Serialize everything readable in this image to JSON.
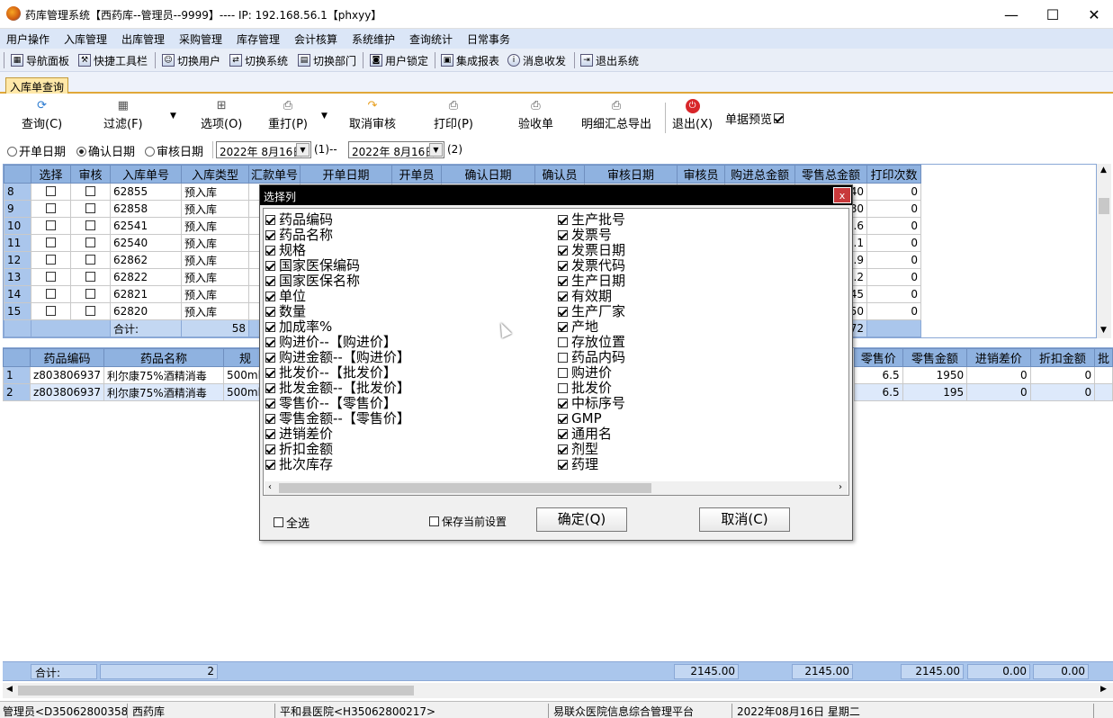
{
  "window": {
    "title": "药库管理系统【西药库--管理员--9999】---- IP: 192.168.56.1【phxyy】",
    "controls": [
      "—",
      "☐",
      "✕"
    ]
  },
  "menu": [
    "用户操作",
    "入库管理",
    "出库管理",
    "采购管理",
    "库存管理",
    "会计核算",
    "系统维护",
    "查询统计",
    "日常事务"
  ],
  "toolbar": [
    "导航面板",
    "快捷工具栏",
    "切换用户",
    "切换系统",
    "切换部门",
    "用户锁定",
    "集成报表",
    "消息收发",
    "退出系统"
  ],
  "tab": "入库单查询",
  "actions": [
    "查询(C)",
    "过滤(F)",
    "选项(O)",
    "重打(P)",
    "取消审核",
    "打印(P)",
    "验收单",
    "明细汇总导出",
    "退出(X)"
  ],
  "preview_label": "单据预览",
  "date_filter": {
    "options": [
      "开单日期",
      "确认日期",
      "审核日期"
    ],
    "selected": "确认日期",
    "from": "2022年 8月16日",
    "to": "2022年 8月16日",
    "sep": "(1)--",
    "end": "(2)"
  },
  "upper_table": {
    "headers": [
      "选择",
      "审核",
      "入库单号",
      "入库类型",
      "汇款单号",
      "开单日期",
      "开单员",
      "确认日期",
      "确认员",
      "审核日期",
      "审核员",
      "购进总金额",
      "零售总金额",
      "打印次数"
    ],
    "rows": [
      {
        "n": "8",
        "no": "62855",
        "type": "预入库",
        "tail": "240",
        "print": "0"
      },
      {
        "n": "9",
        "no": "62858",
        "type": "预入库",
        "tail": "480",
        "print": "0"
      },
      {
        "n": "10",
        "no": "62541",
        "type": "预入库",
        "tail": "5.6",
        "print": "0"
      },
      {
        "n": "11",
        "no": "62540",
        "type": "预入库",
        "tail": "1.1",
        "print": "0"
      },
      {
        "n": "12",
        "no": "62862",
        "type": "预入库",
        "tail": "4.9",
        "print": "0"
      },
      {
        "n": "13",
        "no": "62822",
        "type": "预入库",
        "tail": "5.2",
        "print": "0"
      },
      {
        "n": "14",
        "no": "62821",
        "type": "预入库",
        "tail": "145",
        "print": "0"
      },
      {
        "n": "15",
        "no": "62820",
        "type": "预入库",
        "tail": "150",
        "print": "0"
      }
    ],
    "sum_label": "合计:",
    "sum_count": "58",
    "sum_tail": "72"
  },
  "lower_table": {
    "headers": [
      "药品编码",
      "药品名称",
      "规",
      "零售价",
      "零售金额",
      "进销差价",
      "折扣金额",
      "批"
    ],
    "rows": [
      {
        "n": "1",
        "code": "z803806937",
        "name": "利尔康75%酒精消毒",
        "spec": "500ml",
        "price": "6.5",
        "amount": "1950",
        "diff": "0",
        "discount": "0"
      },
      {
        "n": "2",
        "code": "z803806937",
        "name": "利尔康75%酒精消毒",
        "spec": "500ml",
        "price": "6.5",
        "amount": "195",
        "diff": "0",
        "discount": "0"
      }
    ],
    "sum_label": "合计:",
    "sum_count": "2",
    "sums": [
      "2145.00",
      "2145.00",
      "2145.00",
      "0.00",
      "0.00"
    ]
  },
  "dialog": {
    "title": "选择列",
    "left": [
      {
        "label": "药品编码",
        "checked": true
      },
      {
        "label": "药品名称",
        "checked": true
      },
      {
        "label": "规格",
        "checked": true
      },
      {
        "label": "国家医保编码",
        "checked": true
      },
      {
        "label": "国家医保名称",
        "checked": true
      },
      {
        "label": "单位",
        "checked": true
      },
      {
        "label": "数量",
        "checked": true
      },
      {
        "label": "加成率%",
        "checked": true
      },
      {
        "label": "购进价--【购进价】",
        "checked": true
      },
      {
        "label": "购进金额--【购进价】",
        "checked": true
      },
      {
        "label": "批发价--【批发价】",
        "checked": true
      },
      {
        "label": "批发金额--【批发价】",
        "checked": true
      },
      {
        "label": "零售价--【零售价】",
        "checked": true
      },
      {
        "label": "零售金额--【零售价】",
        "checked": true
      },
      {
        "label": "进销差价",
        "checked": true
      },
      {
        "label": "折扣金额",
        "checked": true
      },
      {
        "label": "批次库存",
        "checked": true
      }
    ],
    "right": [
      {
        "label": "生产批号",
        "checked": true
      },
      {
        "label": "发票号",
        "checked": true
      },
      {
        "label": "发票日期",
        "checked": true
      },
      {
        "label": "发票代码",
        "checked": true
      },
      {
        "label": "生产日期",
        "checked": true
      },
      {
        "label": "有效期",
        "checked": true
      },
      {
        "label": "生产厂家",
        "checked": true
      },
      {
        "label": "产地",
        "checked": true
      },
      {
        "label": "存放位置",
        "checked": false
      },
      {
        "label": "药品内码",
        "checked": false
      },
      {
        "label": "购进价",
        "checked": false
      },
      {
        "label": "批发价",
        "checked": false
      },
      {
        "label": "中标序号",
        "checked": true
      },
      {
        "label": "GMP",
        "checked": true
      },
      {
        "label": "通用名",
        "checked": true
      },
      {
        "label": "剂型",
        "checked": true
      },
      {
        "label": "药理",
        "checked": true
      }
    ],
    "select_all": "全选",
    "save_setting": "保存当前设置",
    "ok": "确定(Q)",
    "cancel": "取消(C)"
  },
  "status": [
    "管理员<D350628003583>",
    "西药库",
    "平和县医院<H35062800217>",
    "易联众医院信息综合管理平台",
    "2022年08月16日 星期二"
  ]
}
